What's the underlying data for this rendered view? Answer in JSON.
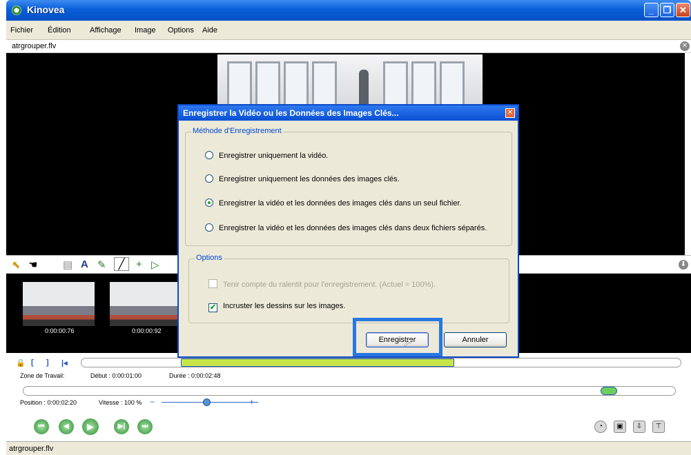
{
  "window": {
    "title": "Kinovea",
    "controls": [
      "_",
      "❐",
      "✕"
    ]
  },
  "menu": [
    "Fichier",
    "Édition",
    "Affichage",
    "Image",
    "Options",
    "Aide"
  ],
  "player": {
    "filename": "atrgrouper.flv",
    "close_glyph": "✕",
    "collapse_glyph": "⬇"
  },
  "drawing_tools": [
    "pointer-icon",
    "hand-icon",
    "comment-icon",
    "text-icon",
    "pencil-icon",
    "line-icon",
    "cross-icon",
    "angle-icon"
  ],
  "thumbnails": [
    {
      "time": "0:00:00:76"
    },
    {
      "time": "0:00:00:92"
    }
  ],
  "timeline": {
    "zone_label": "Zone de Travail:",
    "start_label": "Début : 0:00:01:00",
    "duration_label": "Durée : 0:00:02:48",
    "position_label": "Position : 0:00:02:20",
    "speed_label": "Vitesse : 100 %",
    "speed_minus": "−",
    "speed_plus": "+",
    "playback": [
      "⏮",
      "◀",
      "▶",
      "▶|",
      "⏭"
    ]
  },
  "statusbar": {
    "text": "atrgrouper.flv"
  },
  "dialog": {
    "title": "Enregistrer la Vidéo ou les Données des Images Clés...",
    "method_group": "Méthode d'Enregistrement",
    "methods": [
      {
        "label": "Enregistrer uniquement la vidéo.",
        "selected": false
      },
      {
        "label": "Enregistrer uniquement les données des images clés.",
        "selected": false
      },
      {
        "label": "Enregistrer la vidéo et les données des images clés dans un seul fichier.",
        "selected": true
      },
      {
        "label": "Enregistrer la vidéo et les données des images clés dans deux fichiers séparés.",
        "selected": false
      }
    ],
    "options_group": "Options",
    "options": [
      {
        "label": "Tenir compte du ralentit pour l'enregistrement. (Actuel = 100%).",
        "checked": false,
        "enabled": false
      },
      {
        "label": "Incruster les dessins sur les images.",
        "checked": true,
        "enabled": true
      }
    ],
    "save_button": "Enregistrer",
    "cancel_button": "Annuler",
    "close_glyph": "✕"
  }
}
